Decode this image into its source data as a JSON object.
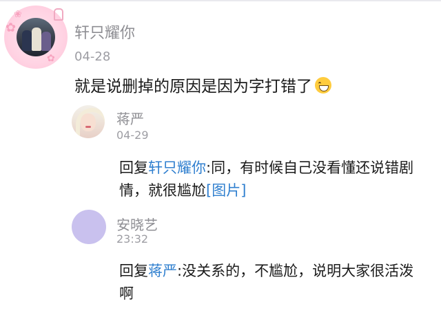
{
  "colors": {
    "link": "#2f7fcf",
    "text": "#1a1a1a",
    "meta": "#9d9da3",
    "avatar_placeholder": "#c9c1ee"
  },
  "comment": {
    "username": "轩只耀你",
    "date": "04-28",
    "text": "就是说删掉的原因是因为字打错了",
    "emoji": "grinning-face-icon"
  },
  "replies": [
    {
      "username": "蒋严",
      "date": "04-29",
      "reply_prefix": "回复",
      "mention": "轩只耀你",
      "text": ":同，有时候自己没看懂还说错剧情，就很尴尬",
      "image_link": "[图片]"
    },
    {
      "username": "安晓艺",
      "date": "23:32",
      "reply_prefix": "回复",
      "mention": "蒋严",
      "text": ":没关系的，不尴尬，说明大家很活泼啊"
    }
  ]
}
